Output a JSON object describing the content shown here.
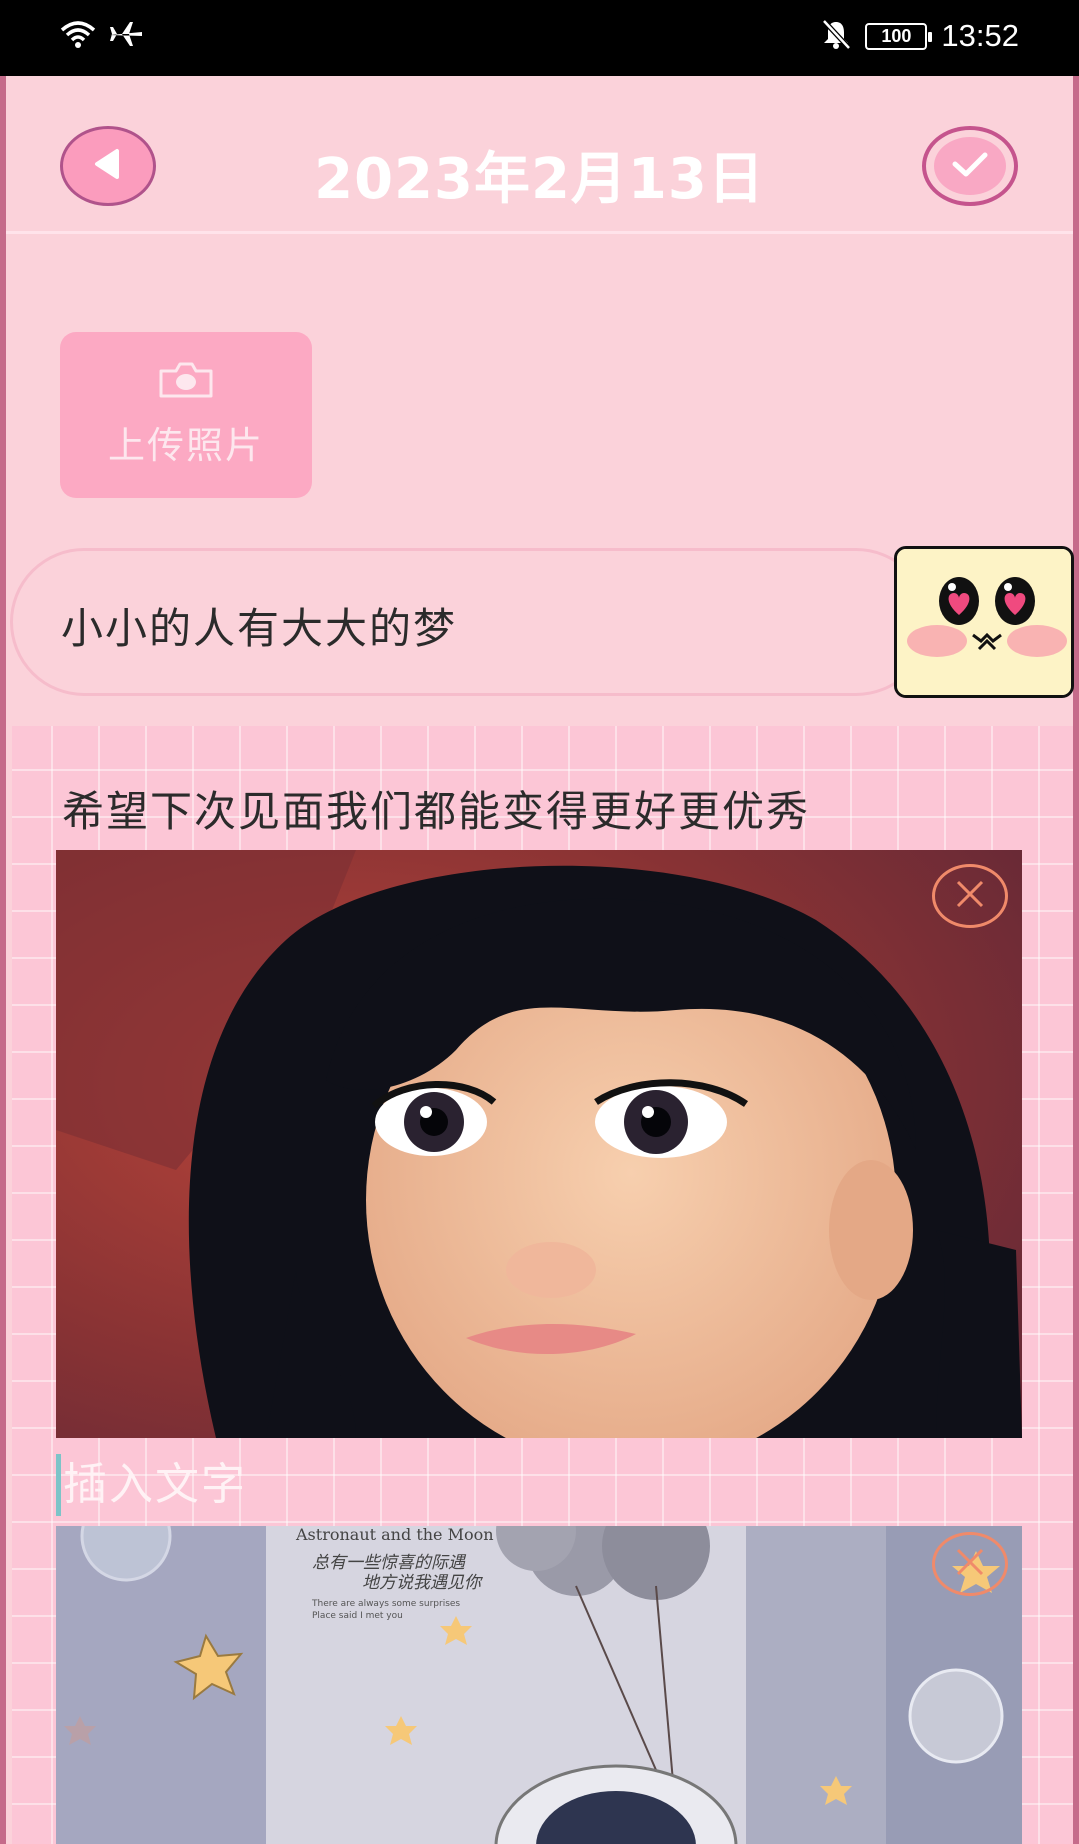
{
  "status_bar": {
    "time": "13:52",
    "battery": "100",
    "icons": [
      "wifi-icon",
      "airplane-mode-icon",
      "notifications-muted-icon",
      "battery-icon"
    ]
  },
  "header": {
    "title": "2023年2月13日",
    "back_icon": "back-triangle-icon",
    "confirm_icon": "checkmark-icon"
  },
  "upload": {
    "label": "上传照片",
    "icon": "camera-icon"
  },
  "diary": {
    "title": "小小的人有大大的梦",
    "body": "希望下次见面我们都能变得更好更优秀",
    "insert_placeholder": "插入文字",
    "photo1_name": "cartoon girl portrait",
    "photo2_text_line1": "Astronaut and the Moon",
    "photo2_text_line2": "总有一些惊喜的际遇",
    "photo2_text_line3": "地方说我遇见你",
    "photo2_text_line4": "There are always some surprises",
    "photo2_text_line5": "Place said I met you"
  },
  "colors": {
    "background": "#fbd2da",
    "accent_pink": "#fb9cbd",
    "border_purple": "#b0538b",
    "remove_orange": "#f08a6a"
  }
}
